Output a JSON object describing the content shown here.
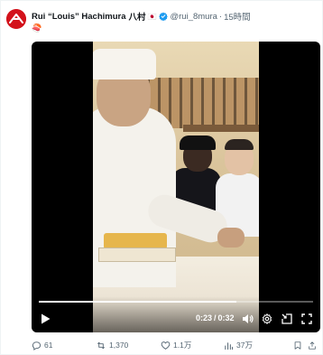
{
  "tweet": {
    "display_name": "Rui “Louis” Hachimura",
    "jp_name": "八村",
    "flag_emoji": "🇯🇵",
    "handle": "@rui_8mura",
    "dot": "·",
    "time": "15時間",
    "emoji_line": "🍣"
  },
  "video": {
    "current_time": "0:23",
    "separator": "/",
    "duration": "0:32",
    "progress": 0.72
  },
  "actions": {
    "replies": "61",
    "reposts": "1,370",
    "likes": "1.1万",
    "views": "37万"
  },
  "colors": {
    "avatar_red": "#d3121b",
    "verified_blue": "#1d9bf0",
    "secondary_text": "#536471"
  },
  "icons": [
    "verified-badge-icon",
    "play-icon",
    "volume-icon",
    "settings-icon",
    "pip-icon",
    "fullscreen-icon",
    "reply-icon",
    "repost-icon",
    "like-icon",
    "views-icon",
    "bookmark-icon",
    "share-icon"
  ]
}
